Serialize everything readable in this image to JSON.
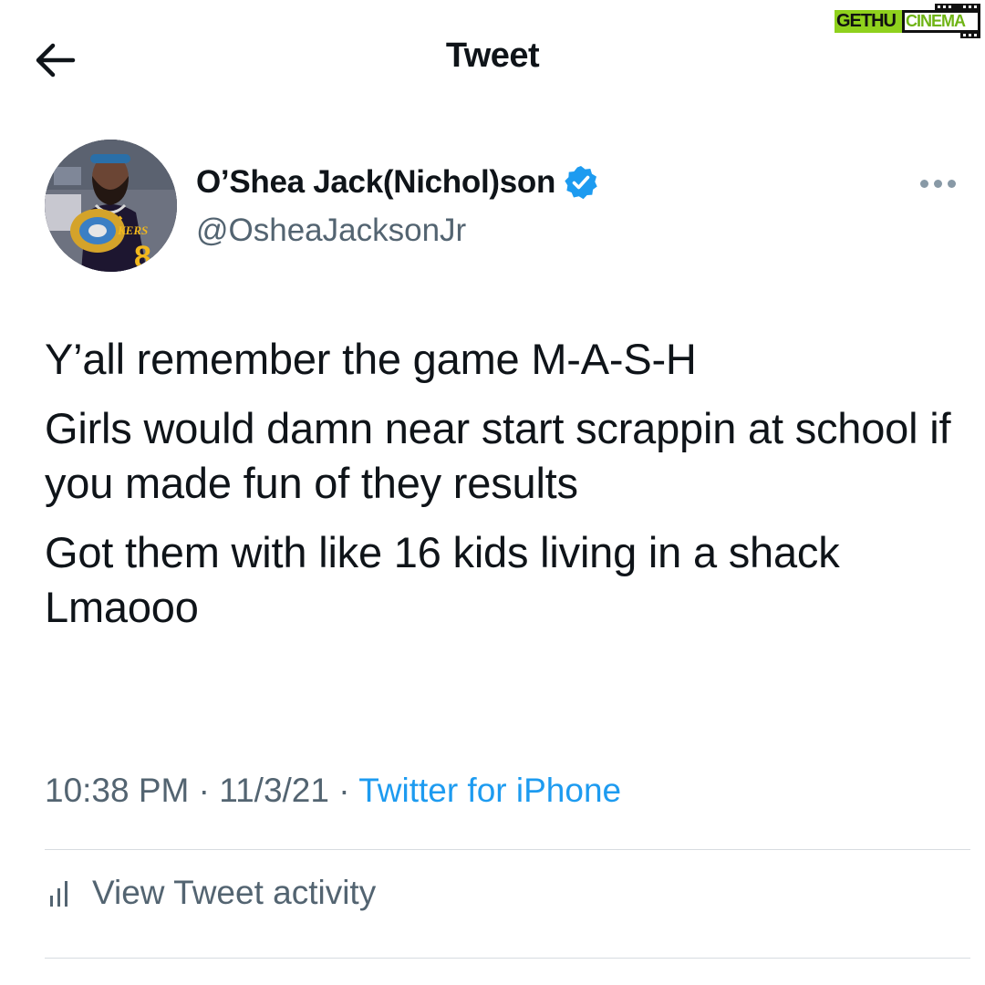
{
  "header": {
    "title": "Tweet",
    "back_icon": "arrow-left-icon"
  },
  "watermark": {
    "part1": "GETHU",
    "part2": "CINEMA"
  },
  "author": {
    "name": "O’Shea Jack(Nichol)son",
    "handle": "@OsheaJacksonJr",
    "verified": true,
    "avatar_jersey_text": "KERS"
  },
  "tweet": {
    "paragraphs": [
      "Y’all remember the game M-A-S-H",
      "Girls would damn near start scrappin at school if you made fun of they results",
      "Got them with like 16 kids living in a shack Lmaooo"
    ]
  },
  "meta": {
    "time": "10:38 PM",
    "separator": " · ",
    "date": "11/3/21",
    "source": "Twitter for iPhone"
  },
  "activity": {
    "label": "View Tweet activity",
    "icon": "bar-chart-icon"
  },
  "colors": {
    "text": "#0f1419",
    "secondary": "#536471",
    "accent": "#1d9bf0",
    "watermark_green": "#8fd11d"
  }
}
